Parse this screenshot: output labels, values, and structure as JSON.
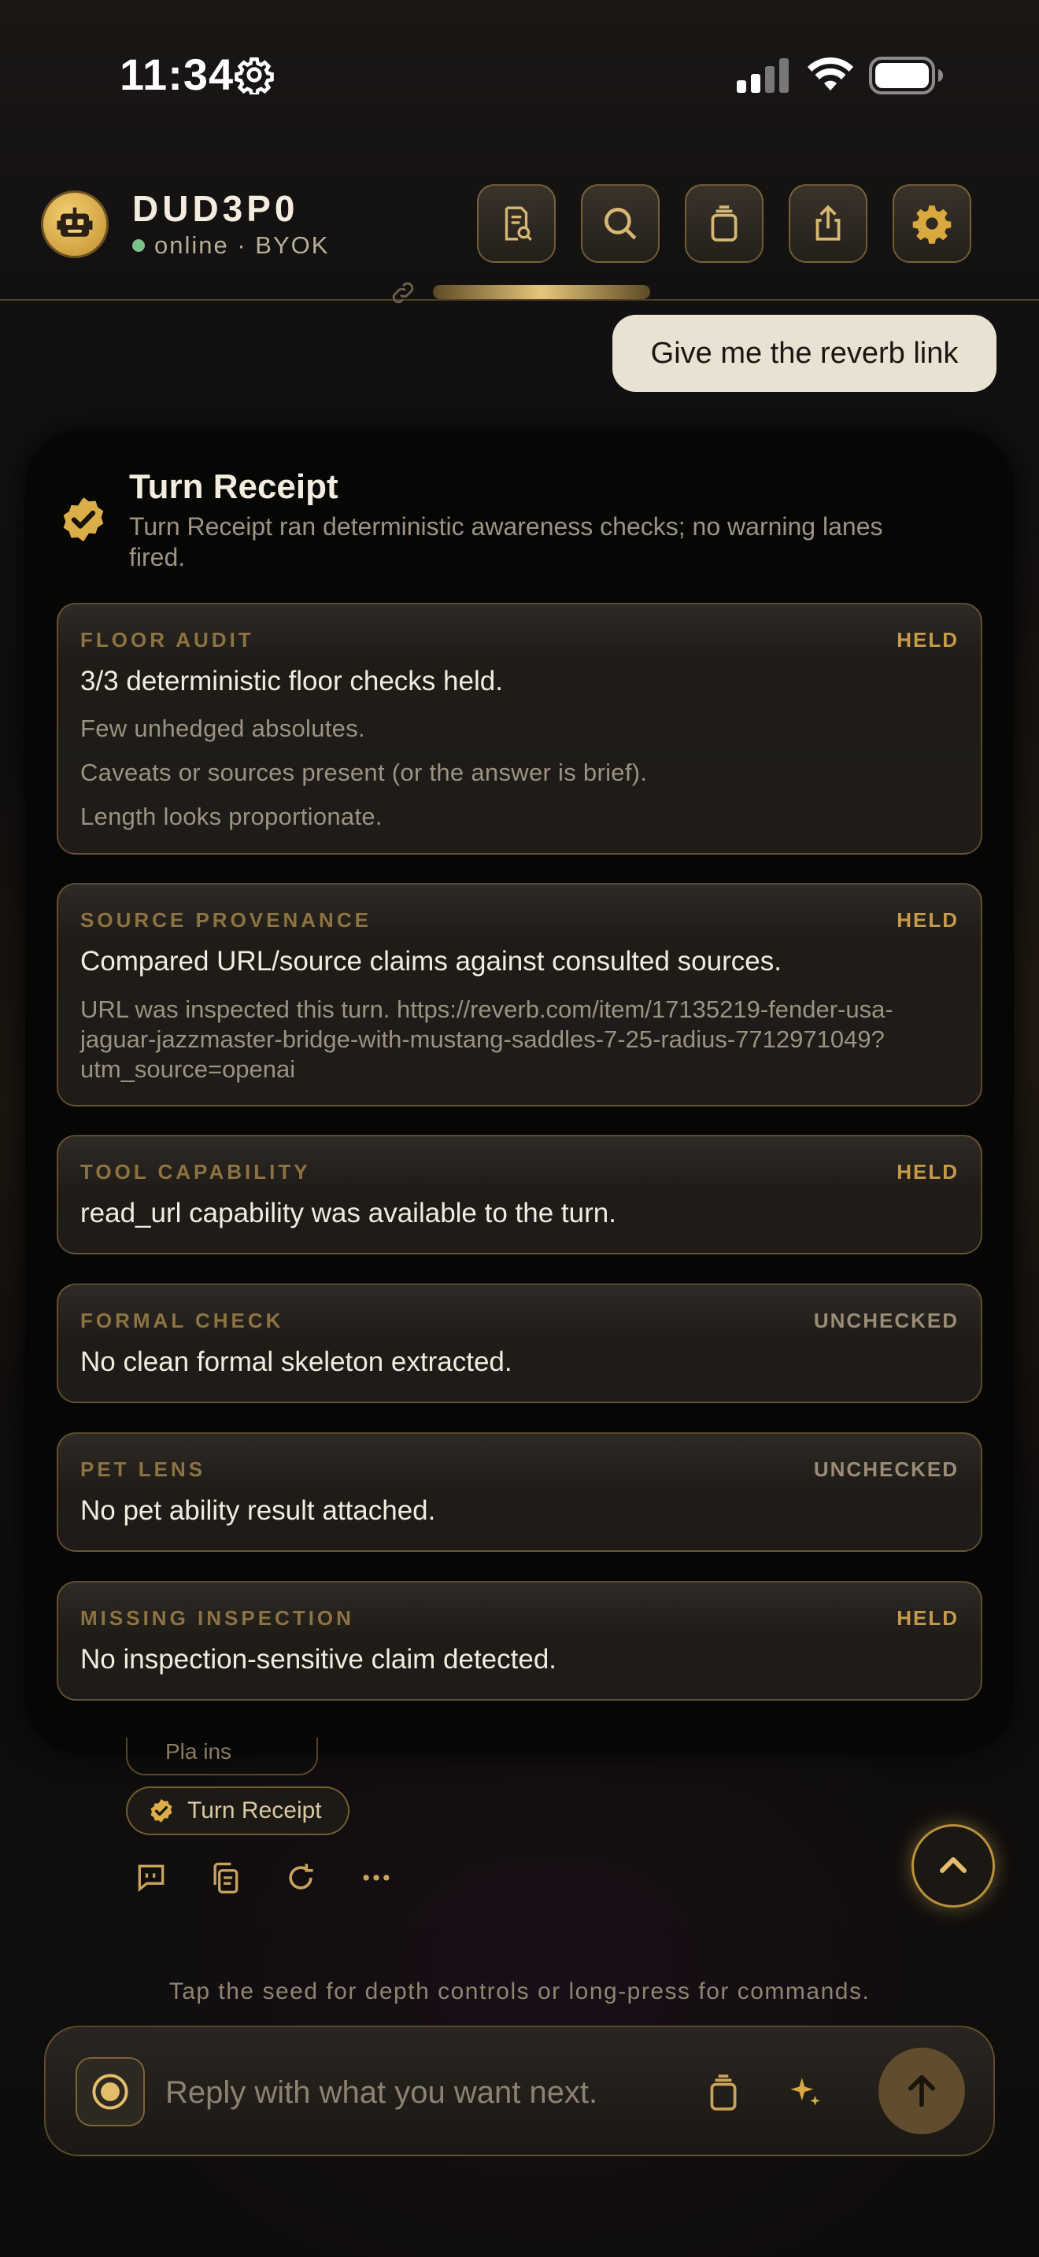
{
  "status_bar": {
    "time": "11:34",
    "icons": [
      "gear-icon",
      "signal-icon",
      "wifi-icon",
      "battery-icon"
    ]
  },
  "header": {
    "bot_name": "DUD3P0",
    "bot_status": "online · BYOK",
    "buttons": [
      "document-search-icon",
      "search-icon",
      "stack-icon",
      "share-icon",
      "settings-icon"
    ]
  },
  "user_message": "Give me the reverb link",
  "receipt": {
    "title": "Turn Receipt",
    "subtitle": "Turn Receipt ran deterministic awareness checks; no warning lanes fired.",
    "cards": [
      {
        "label": "FLOOR AUDIT",
        "status": "HELD",
        "headline": "3/3 deterministic floor checks held.",
        "lines": [
          "Few unhedged absolutes.",
          "Caveats or sources present (or the answer is brief).",
          "Length looks proportionate."
        ]
      },
      {
        "label": "SOURCE PROVENANCE",
        "status": "HELD",
        "headline": "Compared URL/source claims against consulted sources.",
        "detail": "URL was inspected this turn. https://reverb.com/item/17135219-fender-usa-jaguar-jazzmaster-bridge-with-mustang-saddles-7-25-radius-7712971049?utm_source=openai"
      },
      {
        "label": "TOOL CAPABILITY",
        "status": "HELD",
        "headline": "read_url capability was available to the turn."
      },
      {
        "label": "FORMAL CHECK",
        "status": "UNCHECKED",
        "headline": "No clean formal skeleton extracted."
      },
      {
        "label": "PET LENS",
        "status": "UNCHECKED",
        "headline": "No pet ability result attached."
      },
      {
        "label": "MISSING INSPECTION",
        "status": "HELD",
        "headline": "No inspection-sensitive claim detected."
      }
    ]
  },
  "chips": {
    "partial_chip": "Pla  ins",
    "turn_receipt_chip": "Turn Receipt"
  },
  "hint": "Tap the seed for depth controls or long-press for commands.",
  "composer": {
    "placeholder": "Reply with what you want next."
  },
  "colors": {
    "accent_gold": "#c59a4b",
    "user_bubble": "#e9e2d2",
    "online_dot": "#7cc28c"
  }
}
